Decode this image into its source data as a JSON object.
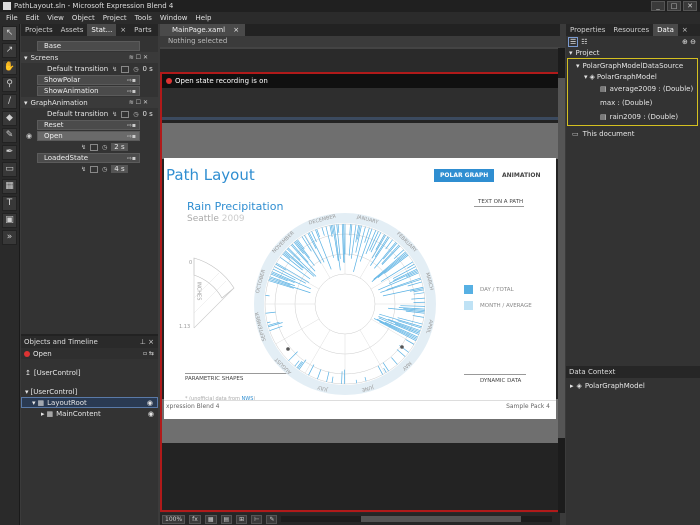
{
  "window": {
    "title": "PathLayout.sln - Microsoft Expression Blend 4",
    "controls": [
      "_",
      "□",
      "✕"
    ]
  },
  "menu": [
    "File",
    "Edit",
    "View",
    "Object",
    "Project",
    "Tools",
    "Window",
    "Help"
  ],
  "left_tabs": [
    "Projects",
    "Assets",
    "Stat...",
    "×",
    "Parts"
  ],
  "states": {
    "base": "Base",
    "group1": "Screens",
    "default_transition": "Default transition",
    "transition_time": "0 s",
    "show_polar": "ShowPolar",
    "show_animation": "ShowAnimation",
    "group2": "GraphAnimation",
    "default_transition2": "Default transition",
    "transition_time2": "0 s",
    "reset": "Reset",
    "open": "Open",
    "open_time": "2 s",
    "loaded": "LoadedState",
    "loaded_time": "4 s"
  },
  "objects": {
    "title": "Objects and Timeline",
    "state_label": "Open",
    "root_label": "[UserControl]",
    "tree": [
      "[UserControl]",
      "LayoutRoot",
      "MainContent"
    ]
  },
  "document": {
    "tab": "MainPage.xaml",
    "selection": "Nothing selected",
    "recording": "Open state recording is on"
  },
  "app": {
    "title": "Path Layout",
    "nav_polar": "POLAR GRAPH",
    "nav_animation": "ANIMATION",
    "chart_title": "Rain Precipitation",
    "city": "Seattle",
    "year": "2009",
    "text_on_path": "TEXT ON A PATH",
    "parametric": "PARAMETRIC SHAPES",
    "dynamic": "DYNAMIC DATA",
    "legend_day": "DAY / TOTAL",
    "legend_month": "MONTH / AVERAGE",
    "source_prefix": "* (unofficial data from",
    "source_nws": "NWS",
    "source_suffix": ")",
    "inches_label": "INCHES",
    "fan_zero": "0",
    "fan_max": "1.13",
    "footer_left": "xpression Blend 4",
    "footer_right": "Sample Pack 4",
    "months": [
      "JANUARY",
      "FEBRUARY",
      "MARCH",
      "APRIL",
      "MAY",
      "JUNE",
      "JULY",
      "AUGUST",
      "SEPTEMBER",
      "OCTOBER",
      "NOVEMBER",
      "DECEMBER"
    ],
    "colors": {
      "accent": "#2f8ed1",
      "light": "#a9d6f0",
      "bar": "#57b0e3"
    }
  },
  "right_tabs": [
    "Properties",
    "Resources",
    "Data",
    "×"
  ],
  "data_panel": {
    "project": "Project",
    "source": "PolarGraphModelDataSource",
    "model": "PolarGraphModel",
    "fields": [
      "average2009 : (Double)",
      "max : (Double)",
      "rain2009 : (Double)"
    ],
    "this_document": "This document",
    "context_title": "Data Context",
    "context_item": "PolarGraphModel"
  },
  "status": {
    "zoom": "100%"
  }
}
